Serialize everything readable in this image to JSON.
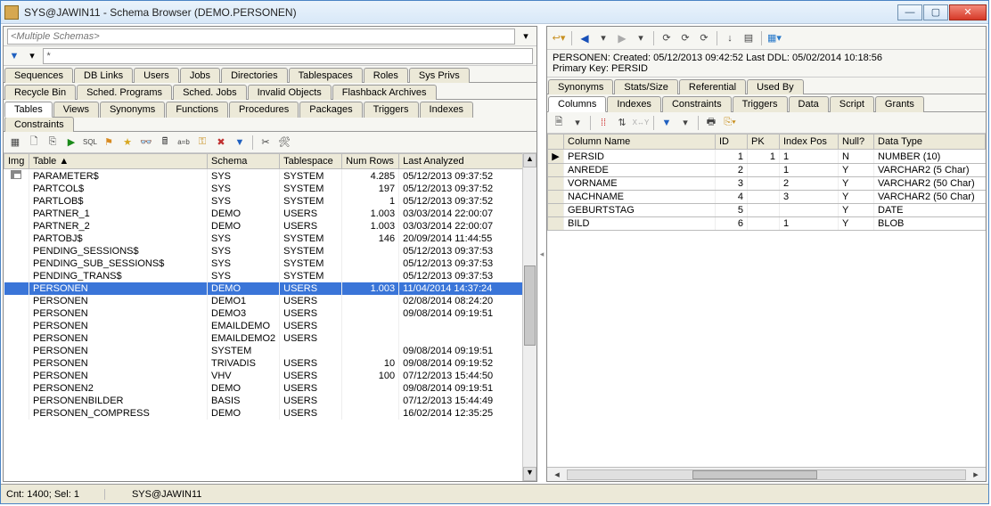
{
  "window": {
    "title": "SYS@JAWIN11 - Schema Browser (DEMO.PERSONEN)"
  },
  "schema_input": {
    "placeholder": "<Multiple Schemas>"
  },
  "filter_input": {
    "value": "*"
  },
  "left_tabs_row1": [
    "Sequences",
    "DB Links",
    "Users",
    "Jobs",
    "Directories",
    "Tablespaces",
    "Roles",
    "Sys Privs"
  ],
  "left_tabs_row2": [
    "Recycle Bin",
    "Sched. Programs",
    "Sched. Jobs",
    "Invalid Objects",
    "Flashback Archives"
  ],
  "left_tabs_row3": [
    "Tables",
    "Views",
    "Synonyms",
    "Functions",
    "Procedures",
    "Packages",
    "Triggers",
    "Indexes",
    "Constraints"
  ],
  "left_tabs_row3_active": 0,
  "left_grid": {
    "columns": [
      "Img",
      "Table",
      "Schema",
      "Tablespace",
      "Num Rows",
      "Last Analyzed"
    ],
    "rows": [
      {
        "img": true,
        "table": "PARAMETER$",
        "schema": "SYS",
        "tbs": "SYSTEM",
        "rows": "4.285",
        "la": "05/12/2013 09:37:52"
      },
      {
        "img": false,
        "table": "PARTCOL$",
        "schema": "SYS",
        "tbs": "SYSTEM",
        "rows": "197",
        "la": "05/12/2013 09:37:52"
      },
      {
        "img": false,
        "table": "PARTLOB$",
        "schema": "SYS",
        "tbs": "SYSTEM",
        "rows": "1",
        "la": "05/12/2013 09:37:52"
      },
      {
        "img": false,
        "table": "PARTNER_1",
        "schema": "DEMO",
        "tbs": "USERS",
        "rows": "1.003",
        "la": "03/03/2014 22:00:07"
      },
      {
        "img": false,
        "table": "PARTNER_2",
        "schema": "DEMO",
        "tbs": "USERS",
        "rows": "1.003",
        "la": "03/03/2014 22:00:07"
      },
      {
        "img": false,
        "table": "PARTOBJ$",
        "schema": "SYS",
        "tbs": "SYSTEM",
        "rows": "146",
        "la": "20/09/2014 11:44:55"
      },
      {
        "img": false,
        "table": "PENDING_SESSIONS$",
        "schema": "SYS",
        "tbs": "SYSTEM",
        "rows": "",
        "la": "05/12/2013 09:37:53"
      },
      {
        "img": false,
        "table": "PENDING_SUB_SESSIONS$",
        "schema": "SYS",
        "tbs": "SYSTEM",
        "rows": "",
        "la": "05/12/2013 09:37:53"
      },
      {
        "img": false,
        "table": "PENDING_TRANS$",
        "schema": "SYS",
        "tbs": "SYSTEM",
        "rows": "",
        "la": "05/12/2013 09:37:53"
      },
      {
        "img": false,
        "table": "PERSONEN",
        "schema": "DEMO",
        "tbs": "USERS",
        "rows": "1.003",
        "la": "11/04/2014 14:37:24",
        "selected": true
      },
      {
        "img": false,
        "table": "PERSONEN",
        "schema": "DEMO1",
        "tbs": "USERS",
        "rows": "",
        "la": "02/08/2014 08:24:20"
      },
      {
        "img": false,
        "table": "PERSONEN",
        "schema": "DEMO3",
        "tbs": "USERS",
        "rows": "",
        "la": "09/08/2014 09:19:51"
      },
      {
        "img": false,
        "table": "PERSONEN",
        "schema": "EMAILDEMO",
        "tbs": "USERS",
        "rows": "",
        "la": ""
      },
      {
        "img": false,
        "table": "PERSONEN",
        "schema": "EMAILDEMO2",
        "tbs": "USERS",
        "rows": "",
        "la": ""
      },
      {
        "img": false,
        "table": "PERSONEN",
        "schema": "SYSTEM",
        "tbs": "",
        "rows": "",
        "la": "09/08/2014 09:19:51"
      },
      {
        "img": false,
        "table": "PERSONEN",
        "schema": "TRIVADIS",
        "tbs": "USERS",
        "rows": "10",
        "la": "09/08/2014 09:19:52"
      },
      {
        "img": false,
        "table": "PERSONEN",
        "schema": "VHV",
        "tbs": "USERS",
        "rows": "100",
        "la": "07/12/2013 15:44:50"
      },
      {
        "img": false,
        "table": "PERSONEN2",
        "schema": "DEMO",
        "tbs": "USERS",
        "rows": "",
        "la": "09/08/2014 09:19:51"
      },
      {
        "img": false,
        "table": "PERSONENBILDER",
        "schema": "BASIS",
        "tbs": "USERS",
        "rows": "",
        "la": "07/12/2013 15:44:49"
      },
      {
        "img": false,
        "table": "PERSONEN_COMPRESS",
        "schema": "DEMO",
        "tbs": "USERS",
        "rows": "",
        "la": "16/02/2014 12:35:25"
      }
    ]
  },
  "right_header": {
    "line1": "PERSONEN:  Created: 05/12/2013 09:42:52  Last DDL: 05/02/2014 10:18:56",
    "line2": "Primary Key:  PERSID"
  },
  "right_tabs_row1": [
    "Synonyms",
    "Stats/Size",
    "Referential",
    "Used By"
  ],
  "right_tabs_row2": [
    "Columns",
    "Indexes",
    "Constraints",
    "Triggers",
    "Data",
    "Script",
    "Grants"
  ],
  "right_tabs_row2_active": 0,
  "right_grid": {
    "columns": [
      "",
      "Column Name",
      "ID",
      "PK",
      "Index Pos",
      "Null?",
      "Data Type"
    ],
    "rows": [
      {
        "mark": "▶",
        "name": "PERSID",
        "id": "1",
        "pk": "1",
        "ipos": "1",
        "null": "N",
        "dtype": "NUMBER (10)"
      },
      {
        "mark": "",
        "name": "ANREDE",
        "id": "2",
        "pk": "",
        "ipos": "1",
        "null": "Y",
        "dtype": "VARCHAR2 (5 Char)"
      },
      {
        "mark": "",
        "name": "VORNAME",
        "id": "3",
        "pk": "",
        "ipos": "2",
        "null": "Y",
        "dtype": "VARCHAR2 (50 Char)"
      },
      {
        "mark": "",
        "name": "NACHNAME",
        "id": "4",
        "pk": "",
        "ipos": "3",
        "null": "Y",
        "dtype": "VARCHAR2 (50 Char)"
      },
      {
        "mark": "",
        "name": "GEBURTSTAG",
        "id": "5",
        "pk": "",
        "ipos": "",
        "null": "Y",
        "dtype": "DATE"
      },
      {
        "mark": "",
        "name": "BILD",
        "id": "6",
        "pk": "",
        "ipos": "1",
        "null": "Y",
        "dtype": "BLOB"
      }
    ]
  },
  "status": {
    "count": "Cnt: 1400; Sel: 1",
    "conn": "SYS@JAWIN11"
  }
}
